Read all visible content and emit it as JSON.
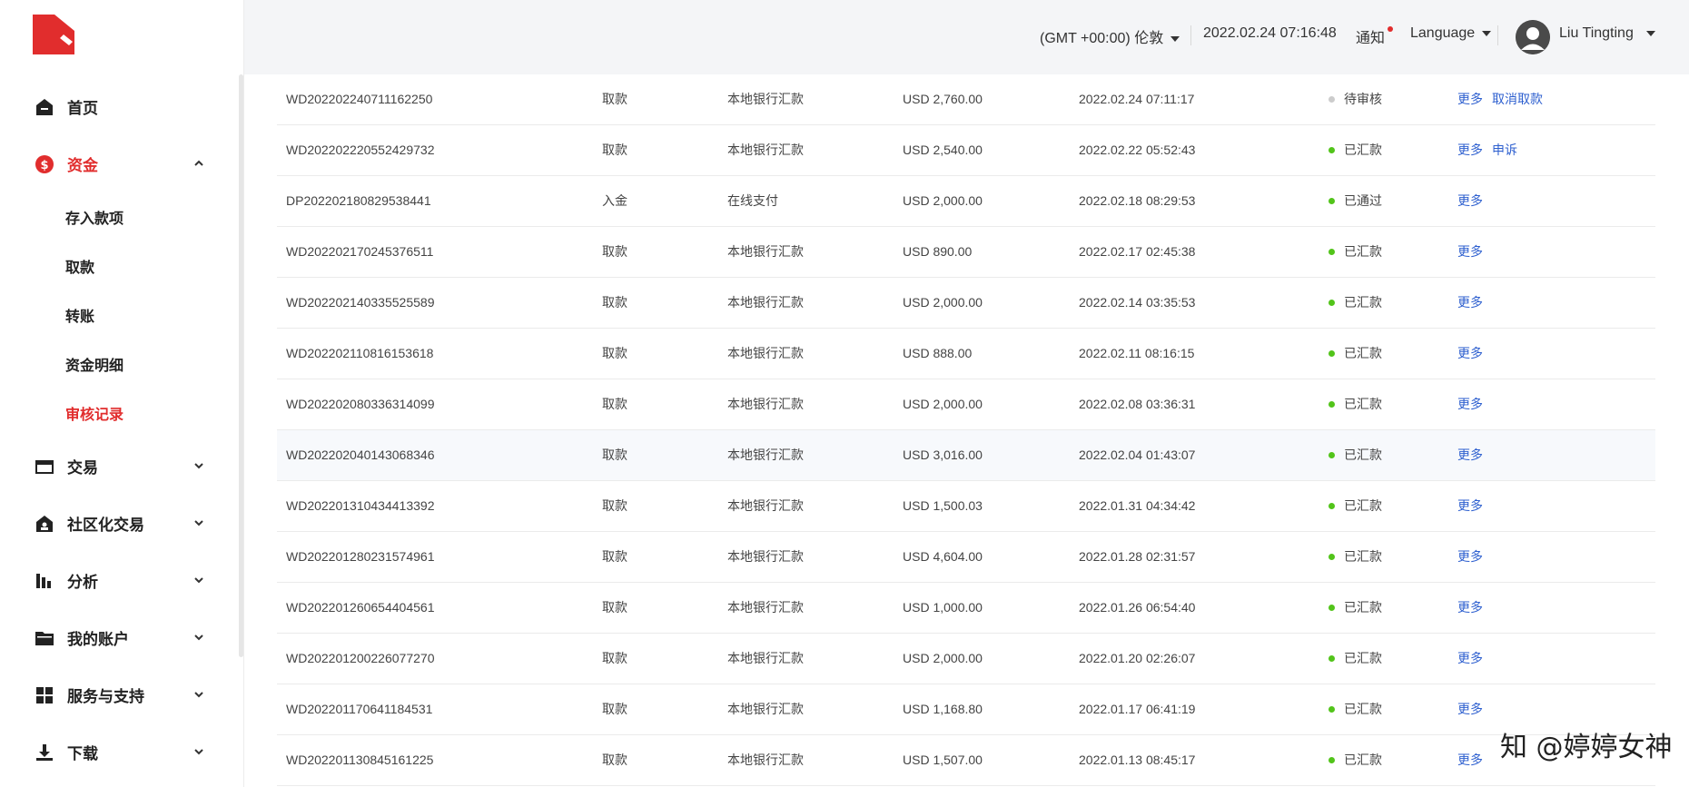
{
  "sidebar": {
    "menu": [
      {
        "label": "首页",
        "icon": "home-icon"
      },
      {
        "label": "资金",
        "icon": "dollar-icon",
        "active": true,
        "expanded": true
      },
      {
        "label": "交易",
        "icon": "card-icon"
      },
      {
        "label": "社区化交易",
        "icon": "community-icon"
      },
      {
        "label": "分析",
        "icon": "bar-chart-icon"
      },
      {
        "label": "我的账户",
        "icon": "folder-icon"
      },
      {
        "label": "服务与支持",
        "icon": "grid-icon"
      },
      {
        "label": "下载",
        "icon": "download-icon"
      }
    ],
    "submenu": [
      "存入款项",
      "取款",
      "转账",
      "资金明细",
      "审核记录"
    ],
    "active_submenu": "审核记录"
  },
  "header": {
    "timezone": "(GMT +00:00) 伦敦",
    "datetime": "2022.02.24 07:16:48",
    "notification": "通知",
    "language": "Language",
    "user": "Liu Tingting"
  },
  "colors": {
    "accent": "#e12d2d",
    "link": "#2d5fcf",
    "success": "#52c41a",
    "pending": "#cccccc"
  },
  "records": [
    {
      "id": "WD202202240711162250",
      "type": "取款",
      "method": "本地银行汇款",
      "amount": "USD 2,760.00",
      "time": "2022.02.24 07:11:17",
      "status": "待审核",
      "status_kind": "pending",
      "ops": [
        "更多",
        "取消取款"
      ]
    },
    {
      "id": "WD202202220552429732",
      "type": "取款",
      "method": "本地银行汇款",
      "amount": "USD 2,540.00",
      "time": "2022.02.22 05:52:43",
      "status": "已汇款",
      "status_kind": "done",
      "ops": [
        "更多",
        "申诉"
      ]
    },
    {
      "id": "DP202202180829538441",
      "type": "入金",
      "method": "在线支付",
      "amount": "USD 2,000.00",
      "time": "2022.02.18 08:29:53",
      "status": "已通过",
      "status_kind": "done",
      "ops": [
        "更多"
      ]
    },
    {
      "id": "WD202202170245376511",
      "type": "取款",
      "method": "本地银行汇款",
      "amount": "USD 890.00",
      "time": "2022.02.17 02:45:38",
      "status": "已汇款",
      "status_kind": "done",
      "ops": [
        "更多"
      ]
    },
    {
      "id": "WD202202140335525589",
      "type": "取款",
      "method": "本地银行汇款",
      "amount": "USD 2,000.00",
      "time": "2022.02.14 03:35:53",
      "status": "已汇款",
      "status_kind": "done",
      "ops": [
        "更多"
      ]
    },
    {
      "id": "WD202202110816153618",
      "type": "取款",
      "method": "本地银行汇款",
      "amount": "USD 888.00",
      "time": "2022.02.11 08:16:15",
      "status": "已汇款",
      "status_kind": "done",
      "ops": [
        "更多"
      ]
    },
    {
      "id": "WD202202080336314099",
      "type": "取款",
      "method": "本地银行汇款",
      "amount": "USD 2,000.00",
      "time": "2022.02.08 03:36:31",
      "status": "已汇款",
      "status_kind": "done",
      "ops": [
        "更多"
      ]
    },
    {
      "id": "WD202202040143068346",
      "type": "取款",
      "method": "本地银行汇款",
      "amount": "USD 3,016.00",
      "time": "2022.02.04 01:43:07",
      "status": "已汇款",
      "status_kind": "done",
      "ops": [
        "更多"
      ],
      "hover": true
    },
    {
      "id": "WD202201310434413392",
      "type": "取款",
      "method": "本地银行汇款",
      "amount": "USD 1,500.03",
      "time": "2022.01.31 04:34:42",
      "status": "已汇款",
      "status_kind": "done",
      "ops": [
        "更多"
      ]
    },
    {
      "id": "WD202201280231574961",
      "type": "取款",
      "method": "本地银行汇款",
      "amount": "USD 4,604.00",
      "time": "2022.01.28 02:31:57",
      "status": "已汇款",
      "status_kind": "done",
      "ops": [
        "更多"
      ]
    },
    {
      "id": "WD202201260654404561",
      "type": "取款",
      "method": "本地银行汇款",
      "amount": "USD 1,000.00",
      "time": "2022.01.26 06:54:40",
      "status": "已汇款",
      "status_kind": "done",
      "ops": [
        "更多"
      ]
    },
    {
      "id": "WD202201200226077270",
      "type": "取款",
      "method": "本地银行汇款",
      "amount": "USD 2,000.00",
      "time": "2022.01.20 02:26:07",
      "status": "已汇款",
      "status_kind": "done",
      "ops": [
        "更多"
      ]
    },
    {
      "id": "WD202201170641184531",
      "type": "取款",
      "method": "本地银行汇款",
      "amount": "USD 1,168.80",
      "time": "2022.01.17 06:41:19",
      "status": "已汇款",
      "status_kind": "done",
      "ops": [
        "更多"
      ]
    },
    {
      "id": "WD202201130845161225",
      "type": "取款",
      "method": "本地银行汇款",
      "amount": "USD 1,507.00",
      "time": "2022.01.13 08:45:17",
      "status": "已汇款",
      "status_kind": "done",
      "ops": [
        "更多"
      ]
    }
  ],
  "watermark": "知 @婷婷女神"
}
